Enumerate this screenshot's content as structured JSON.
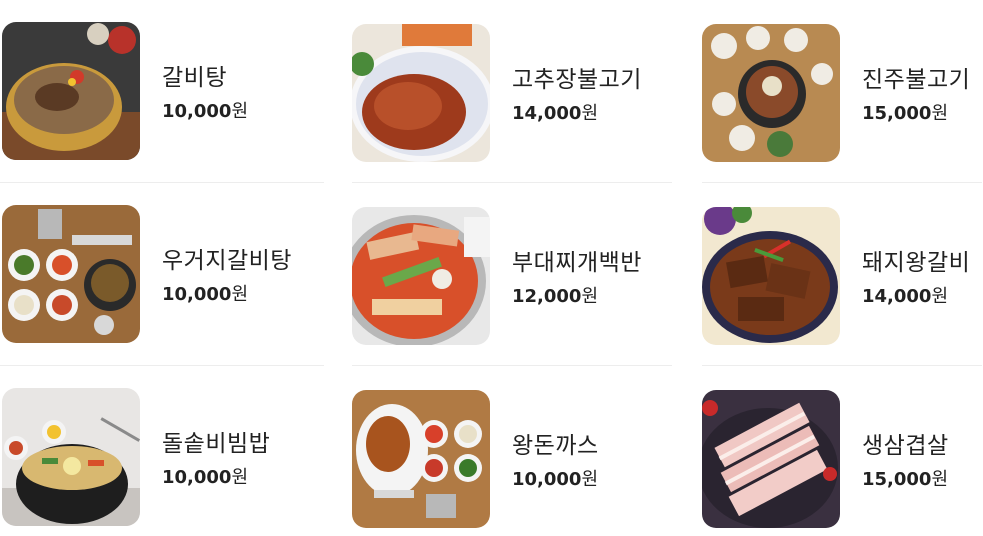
{
  "menu": {
    "items": [
      {
        "name": "갈비탕",
        "amount": "10,000",
        "unit": "원",
        "icon": "galbitang-photo"
      },
      {
        "name": "고추장불고기",
        "amount": "14,000",
        "unit": "원",
        "icon": "gochujang-bulgogi-photo"
      },
      {
        "name": "진주불고기",
        "amount": "15,000",
        "unit": "원",
        "icon": "jinju-bulgogi-photo"
      },
      {
        "name": "우거지갈비탕",
        "amount": "10,000",
        "unit": "원",
        "icon": "ugeoji-galbitang-photo"
      },
      {
        "name": "부대찌개백반",
        "amount": "12,000",
        "unit": "원",
        "icon": "budae-jjigae-photo"
      },
      {
        "name": "돼지왕갈비",
        "amount": "14,000",
        "unit": "원",
        "icon": "pork-galbi-photo"
      },
      {
        "name": "돌솥비빔밥",
        "amount": "10,000",
        "unit": "원",
        "icon": "dolsot-bibimbap-photo"
      },
      {
        "name": "왕돈까스",
        "amount": "10,000",
        "unit": "원",
        "icon": "wang-donkatsu-photo"
      },
      {
        "name": "생삼겹살",
        "amount": "15,000",
        "unit": "원",
        "icon": "samgyeopsal-photo"
      }
    ]
  }
}
